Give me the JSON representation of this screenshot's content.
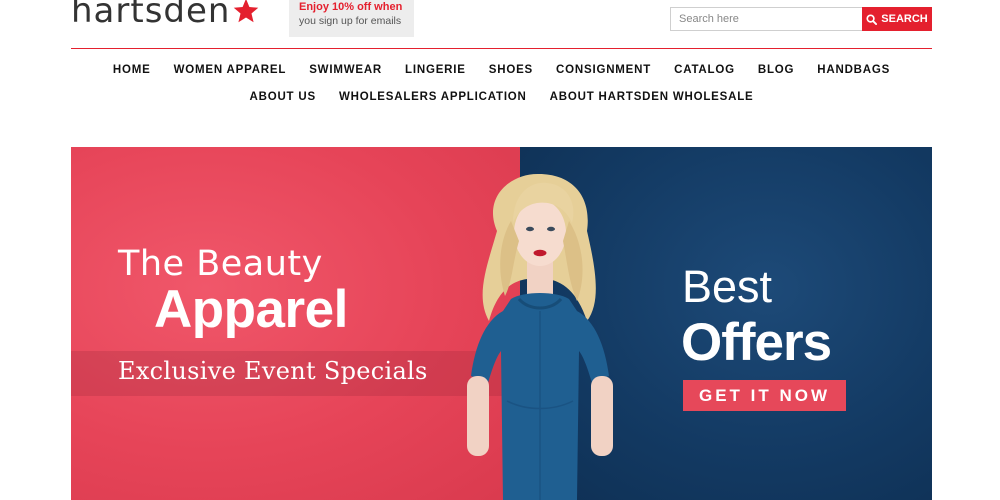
{
  "brand": {
    "logo_text": "hartsden",
    "logo_icon": "star-icon",
    "accent_color": "#e4202e"
  },
  "promo": {
    "line1": "Enjoy 10% off when",
    "line2": "you sign up for emails"
  },
  "search": {
    "placeholder": "Search here",
    "value": "",
    "button_label": "SEARCH",
    "button_icon": "search-icon"
  },
  "nav": {
    "row1": [
      "HOME",
      "WOMEN APPAREL",
      "SWIMWEAR",
      "LINGERIE",
      "SHOES",
      "CONSIGNMENT",
      "CATALOG",
      "BLOG",
      "HANDBAGS"
    ],
    "row2": [
      "ABOUT US",
      "WHOLESALERS APPLICATION",
      "ABOUT HARTSDEN WHOLESALE"
    ]
  },
  "hero": {
    "left_color": "#e64458",
    "right_color": "#133a63",
    "headline_light": "The Beauty",
    "headline_bold": "Apparel",
    "subheadline": "Exclusive Event Specials",
    "offer_light": "Best",
    "offer_bold": "Offers",
    "cta_label": "GET IT NOW"
  }
}
